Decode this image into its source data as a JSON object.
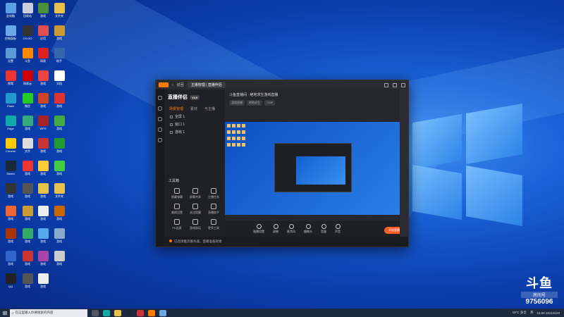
{
  "desktop": {
    "icons": [
      {
        "label": "此电脑",
        "color": "#5aa0e6"
      },
      {
        "label": "回收站",
        "color": "#ccd"
      },
      {
        "label": "游戏",
        "color": "#4a8f3a"
      },
      {
        "label": "文件夹",
        "color": "#e8c14a"
      },
      {
        "label": "控制面板",
        "color": "#6aa8e8"
      },
      {
        "label": "CS:GO",
        "color": "#333"
      },
      {
        "label": "应用",
        "color": "#e34f4f"
      },
      {
        "label": "游戏",
        "color": "#c93"
      },
      {
        "label": "设置",
        "color": "#5c9ad6"
      },
      {
        "label": "斗鱼",
        "color": "#f80"
      },
      {
        "label": "网易",
        "color": "#d22"
      },
      {
        "label": "助手",
        "color": "#36a"
      },
      {
        "label": "视频",
        "color": "#e33"
      },
      {
        "label": "网易云",
        "color": "#c00"
      },
      {
        "label": "游戏",
        "color": "#e44"
      },
      {
        "label": "文档",
        "color": "#fff"
      },
      {
        "label": "Flash",
        "color": "#29c"
      },
      {
        "label": "微信",
        "color": "#2c2"
      },
      {
        "label": "游戏",
        "color": "#c42"
      },
      {
        "label": "游戏",
        "color": "#d33"
      },
      {
        "label": "Edge",
        "color": "#1aa"
      },
      {
        "label": "游戏",
        "color": "#3a7"
      },
      {
        "label": "WPS",
        "color": "#a22"
      },
      {
        "label": "游戏",
        "color": "#4a4"
      },
      {
        "label": "Chrome",
        "color": "#fc0"
      },
      {
        "label": "文件",
        "color": "#ddd"
      },
      {
        "label": "游戏",
        "color": "#c33"
      },
      {
        "label": "游戏",
        "color": "#293"
      },
      {
        "label": "Steam",
        "color": "#1b2838"
      },
      {
        "label": "游戏",
        "color": "#e33"
      },
      {
        "label": "游戏",
        "color": "#fc3"
      },
      {
        "label": "游戏",
        "color": "#4c4"
      },
      {
        "label": "游戏",
        "color": "#333"
      },
      {
        "label": "游戏",
        "color": "#555"
      },
      {
        "label": "游戏",
        "color": "#e8c14a"
      },
      {
        "label": "文件夹",
        "color": "#e8c14a"
      },
      {
        "label": "游戏",
        "color": "#e63"
      },
      {
        "label": "游戏",
        "color": "#c93"
      },
      {
        "label": "游戏",
        "color": "#eee"
      },
      {
        "label": "游戏",
        "color": "#c60"
      },
      {
        "label": "游戏",
        "color": "#a30"
      },
      {
        "label": "游戏",
        "color": "#3a6"
      },
      {
        "label": "游戏",
        "color": "#5ae"
      },
      {
        "label": "游戏",
        "color": "#8ac"
      },
      {
        "label": "游戏",
        "color": "#36c"
      },
      {
        "label": "游戏",
        "color": "#c33"
      },
      {
        "label": "游戏",
        "color": "#a4a"
      },
      {
        "label": "游戏",
        "color": "#ccc"
      },
      {
        "label": "QQ",
        "color": "#222"
      },
      {
        "label": "游戏",
        "color": "#555"
      },
      {
        "label": "游戏",
        "color": "#eee"
      }
    ]
  },
  "app": {
    "tab_title": "主播管理 | 直播伴侣",
    "nav_back": "返回",
    "brand": "直播伴侣",
    "brand_badge": "V4.0",
    "panel_tabs": [
      "场景管理",
      "素材",
      "与主播"
    ],
    "scenes": [
      "全屏 1",
      "窗口 1",
      "游戏 1"
    ],
    "tools_title": "工具箱",
    "tools": [
      "隐藏弹幕",
      "屏幕共享",
      "主播任务",
      "美颜设置",
      "关注提醒",
      "直播助手",
      "PK连麦",
      "游戏陪玩",
      "更多工具"
    ],
    "status_text": "已连接推流服务器，直播准备就绪",
    "room_title": "斗鱼直播间 · 绝地求生游戏直播",
    "room_tags": [
      "游戏直播",
      "绝地求生",
      "720P"
    ],
    "bottom_items": [
      "直播设置",
      "录制",
      "麦克风",
      "摄像头",
      "音量",
      "声音"
    ],
    "live_button": "开始直播"
  },
  "watermark": {
    "logo": "斗鱼",
    "sub": "房间号",
    "room_number": "9756096"
  },
  "taskbar": {
    "search_placeholder": "在这里输入你要搜索的内容",
    "tray_weather": "19°C 多云",
    "tray_lang": "英",
    "tray_time": "15:06",
    "tray_date": "2021/5/20"
  }
}
